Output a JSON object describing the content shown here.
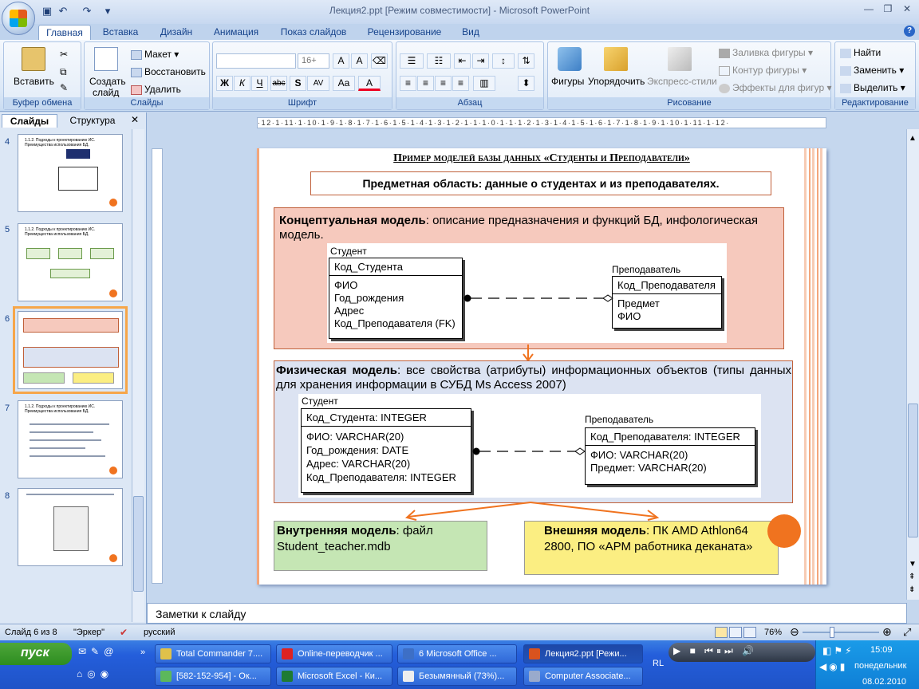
{
  "window": {
    "title": "Лекция2.ppt [Режим совместимости] - Microsoft PowerPoint",
    "qat": [
      "save-icon",
      "undo-icon",
      "redo-icon",
      "customize-icon"
    ]
  },
  "tabs": [
    "Главная",
    "Вставка",
    "Дизайн",
    "Анимация",
    "Показ слайдов",
    "Рецензирование",
    "Вид"
  ],
  "ribbon": {
    "clipboard": {
      "label": "Буфер обмена",
      "paste": "Вставить"
    },
    "slides": {
      "label": "Слайды",
      "create": "Создать",
      "create2": "слайд",
      "layout": "Макет",
      "reset": "Восстановить",
      "delete": "Удалить"
    },
    "font": {
      "label": "Шрифт",
      "size": "16+",
      "buttons": [
        "Ж",
        "К",
        "Ч",
        "abc",
        "S",
        "AV",
        "Aa",
        "A"
      ]
    },
    "paragraph": {
      "label": "Абзац"
    },
    "drawing": {
      "label": "Рисование",
      "shapes": "Фигуры",
      "arrange": "Упорядочить",
      "quickstyles": "Экспресс-стили",
      "fill": "Заливка фигуры",
      "outline": "Контур фигуры",
      "effects": "Эффекты для фигур"
    },
    "editing": {
      "label": "Редактирование",
      "find": "Найти",
      "replace": "Заменить",
      "select": "Выделить"
    }
  },
  "panel": {
    "tab_slides": "Слайды",
    "tab_outline": "Структура"
  },
  "thumbs": [
    {
      "num": "4",
      "title": "1.1.2. Подходы к проектированию ИС. Преимущества использования БД."
    },
    {
      "num": "5",
      "title": "1.1.2. Подходы к проектированию ИС. Преимущества использования БД."
    },
    {
      "num": "6",
      "title": ""
    },
    {
      "num": "7",
      "title": "1.1.2. Подходы к проектированию ИС. Преимущества использования БД."
    },
    {
      "num": "8",
      "title": ""
    }
  ],
  "ruler_text": "·12·1·11·1·10·1·9·1·8·1·7·1·6·1·5·1·4·1·3·1·2·1·1·1·0·1·1·1·2·1·3·1·4·1·5·1·6·1·7·1·8·1·9·1·10·1·11·1·12·",
  "slide": {
    "title": "Пример моделей базы данных «Студенты и Преподаватели»",
    "subject": "Предметная область: данные о студентах и из преподавателях",
    "conceptual_bold": "Концептуальная модель",
    "conceptual_text": ": описание предназначения и функций БД, инфологическая модель.",
    "c_student_label": "Студент",
    "c_student_key": "Код_Студента",
    "c_student_attrs": [
      "ФИО",
      "Год_рождения",
      "Адрес",
      "Код_Преподавателя (FK)"
    ],
    "c_teacher_label": "Преподаватель",
    "c_teacher_key": "Код_Преподавателя",
    "c_teacher_attrs": [
      "Предмет",
      "ФИО"
    ],
    "physical_bold": "Физическая модель",
    "physical_text": ": все свойства (атрибуты) информационных объектов (типы данных для хранения информации в СУБД Ms Access 2007)",
    "p_student_label": "Студент",
    "p_student_key": "Код_Студента: INTEGER",
    "p_student_attrs": [
      "ФИО: VARCHAR(20)",
      "Год_рождения: DATE",
      "Адрес: VARCHAR(20)",
      "Код_Преподавателя: INTEGER"
    ],
    "p_teacher_label": "Преподаватель",
    "p_teacher_key": "Код_Преподавателя: INTEGER",
    "p_teacher_attrs": [
      "ФИО: VARCHAR(20)",
      "Предмет: VARCHAR(20)"
    ],
    "internal_bold": "Внутренняя модель",
    "internal_text": ": файл Student_teacher.mdb",
    "external_bold": "Внешняя модель",
    "external_text": ": ПК AMD Athlon64 2800, ПО «АРМ работника деканата»"
  },
  "notes_placeholder": "Заметки к слайду",
  "status": {
    "slide": "Слайд 6 из 8",
    "theme": "\"Эркер\"",
    "lang": "русский",
    "zoom": "76%"
  },
  "taskbar": {
    "start": "пуск",
    "row1": [
      "Total Commander 7....",
      "Online-переводчик ...",
      "6 Microsoft Office ...",
      "Лекция2.ppt [Режи..."
    ],
    "row2": [
      "[582-152-954] - Ок...",
      "Microsoft Excel - Ки...",
      "Безымянный (73%)...",
      "Computer Associate..."
    ],
    "lang": "RL",
    "time": "15:09",
    "day": "понедельник",
    "date": "08.02.2010"
  },
  "colors": {
    "accent": "#f0731f",
    "conceptual_bg": "#f6c9bd",
    "physical_bg": "#dce3f2",
    "internal_bg": "#c5e6b4",
    "external_bg": "#fbee82"
  }
}
